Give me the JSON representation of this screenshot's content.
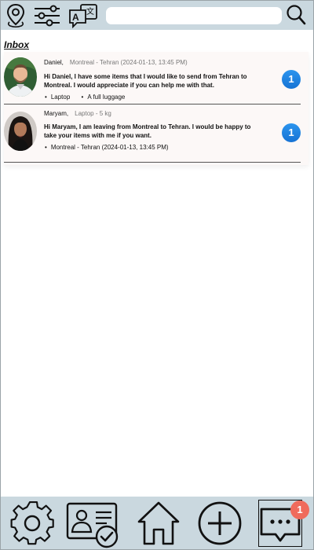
{
  "header": {
    "search_placeholder": "",
    "icons": [
      "location-icon",
      "filter-sliders-icon",
      "translate-icon",
      "search-icon"
    ]
  },
  "inbox": {
    "title": "Inbox",
    "items": [
      {
        "name": "Daniel,",
        "subtitle": "Montreal - Tehran (2024-01-13, 13:45 PM)",
        "message": "Hi Daniel,  I have some items that I would like to send from Tehran to Montreal. I would appreciate if you can help me with that.",
        "tags": [
          "Laptop",
          "A full luggage"
        ],
        "unread": "1"
      },
      {
        "name": "Maryam,",
        "subtitle": "Laptop - 5 kg",
        "message": "Hi Maryam, I am leaving from Montreal to Tehran. I would be happy to take your items with me if you want.",
        "tags": [
          "Montreal - Tehran (2024-01-13, 13:45 PM)"
        ],
        "unread": "1"
      }
    ]
  },
  "bottom_nav": {
    "items": [
      "settings-icon",
      "profile-verified-icon",
      "home-icon",
      "add-icon",
      "messages-icon"
    ],
    "active": "messages-icon",
    "messages_badge": "1"
  },
  "colors": {
    "bar_bg": "#cad8df",
    "list_bg": "#fcf8f7",
    "badge_blue": "#1f84e3",
    "notif_red": "#f06b5c"
  }
}
